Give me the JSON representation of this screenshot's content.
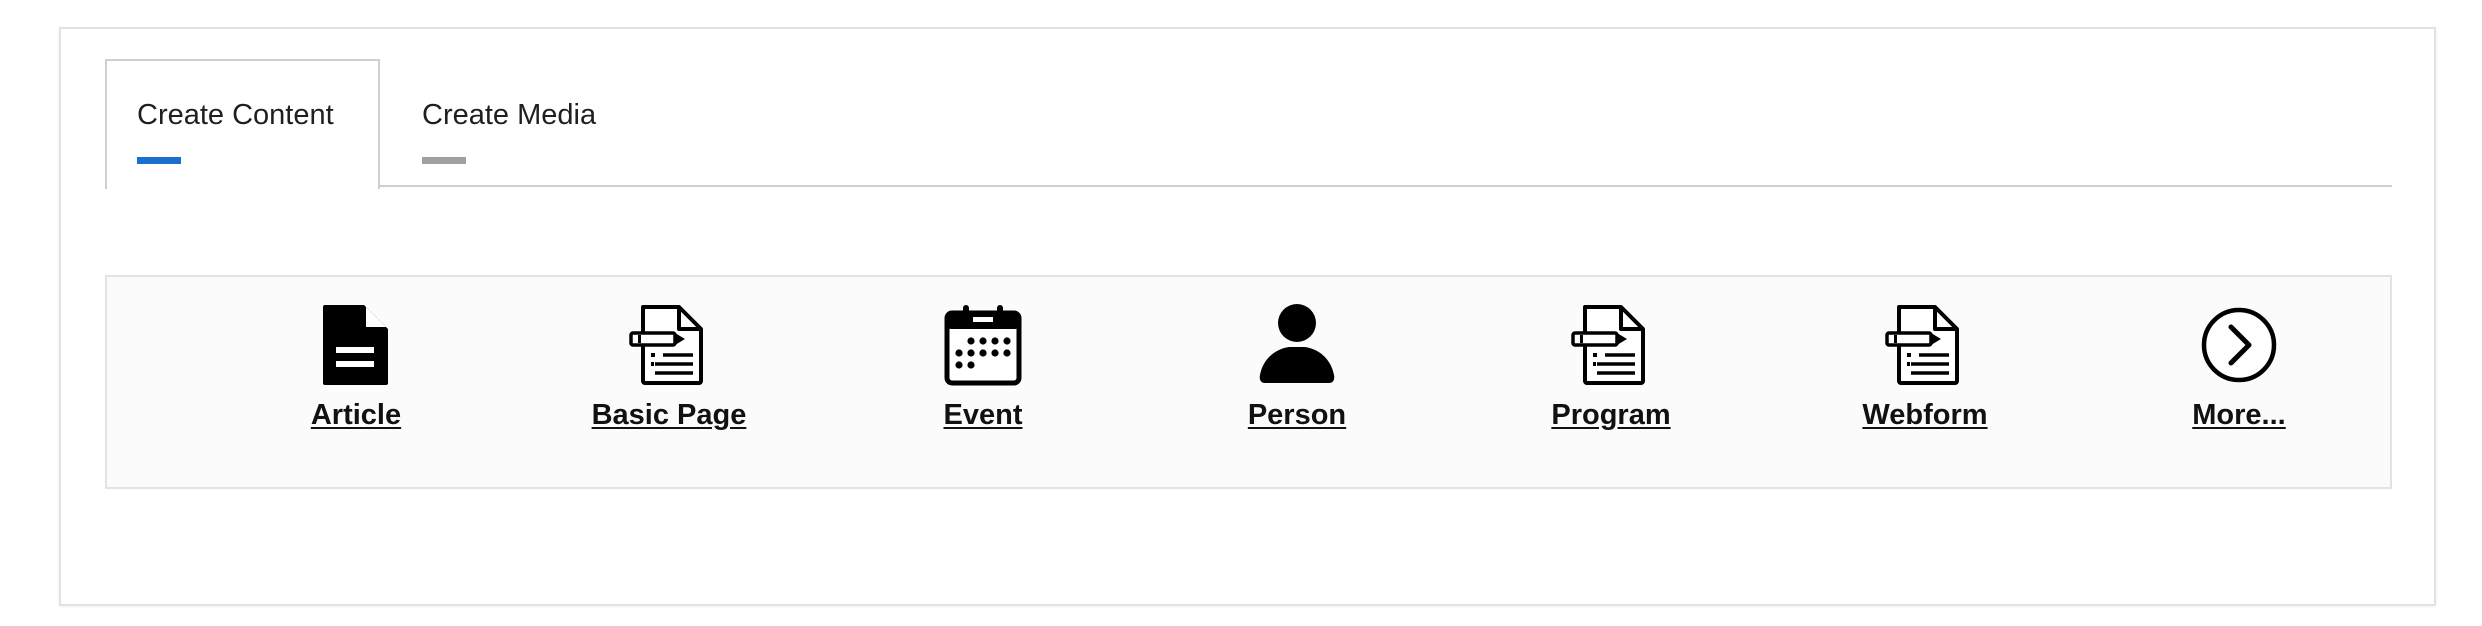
{
  "tabs": [
    {
      "label": "Create Content",
      "active": true,
      "indicator_color": "#1a6fd1"
    },
    {
      "label": "Create Media",
      "active": false,
      "indicator_color": "#a0a0a0"
    }
  ],
  "items": [
    {
      "label": "Article",
      "icon": "document-filled-icon"
    },
    {
      "label": "Basic Page",
      "icon": "document-edit-icon"
    },
    {
      "label": "Event",
      "icon": "calendar-icon"
    },
    {
      "label": "Person",
      "icon": "person-icon"
    },
    {
      "label": "Program",
      "icon": "document-edit-icon"
    },
    {
      "label": "Webform",
      "icon": "document-edit-icon"
    },
    {
      "label": "More...",
      "icon": "chevron-right-circle-icon"
    }
  ]
}
